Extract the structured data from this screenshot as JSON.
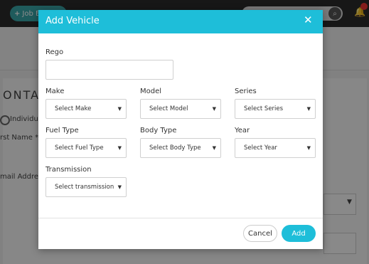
{
  "app": {
    "job_button_label": "Job E",
    "contact_heading": "ONTAC",
    "individual_label": "Individu",
    "first_name_label": "rst Name *",
    "email_label": "mail Address"
  },
  "modal": {
    "title": "Add Vehicle",
    "close_glyph": "✕",
    "rego": {
      "label": "Rego",
      "value": ""
    },
    "make": {
      "label": "Make",
      "value": "Select Make"
    },
    "model": {
      "label": "Model",
      "value": "Select Model"
    },
    "series": {
      "label": "Series",
      "value": "Select Series"
    },
    "fuel_type": {
      "label": "Fuel Type",
      "value": "Select Fuel Type"
    },
    "body_type": {
      "label": "Body Type",
      "value": "Select Body Type"
    },
    "year": {
      "label": "Year",
      "value": "Select Year"
    },
    "transmission": {
      "label": "Transmission",
      "value": "Select transmission"
    },
    "cancel_label": "Cancel",
    "add_label": "Add"
  },
  "icons": {
    "dropdown_arrow": "▼",
    "search": "search-icon",
    "bell": "bell-icon"
  },
  "colors": {
    "accent": "#1ebed9",
    "topbar": "#2a2a2a",
    "job_button": "#3aa6a8"
  }
}
